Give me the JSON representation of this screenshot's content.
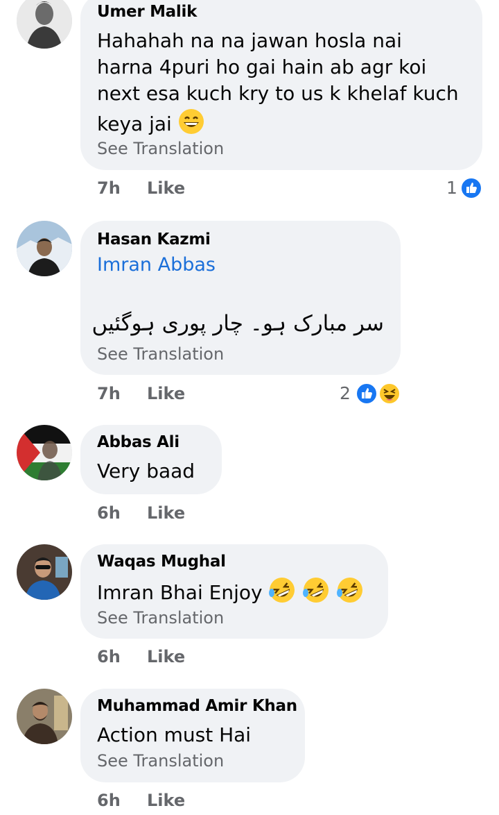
{
  "comments": [
    {
      "name": "Umer Malik",
      "lines": [
        "Hahahah na na  jawan hosla nai",
        "harna 4puri ho gai hain ab agr koi",
        "next esa kuch kry to us k khelaf kuch",
        "keya jai"
      ],
      "see_translation": "See Translation",
      "time": "7h",
      "like": "Like",
      "reaction_count": "1",
      "reaction_icons": [
        "like-reaction-icon"
      ]
    },
    {
      "name": "Hasan Kazmi",
      "mention": "Imran Abbas",
      "urdu": "سر مبارک ہو۔ چار پوری ہوگئیں",
      "see_translation": "See Translation",
      "time": "7h",
      "like": "Like",
      "reaction_count": "2",
      "reaction_icons": [
        "like-reaction-icon",
        "haha-reaction-icon"
      ]
    },
    {
      "name": "Abbas Ali",
      "lines": [
        "Very baad"
      ],
      "time": "6h",
      "like": "Like"
    },
    {
      "name": "Waqas Mughal",
      "lines": [
        "Imran Bhai Enjoy"
      ],
      "emojis": [
        "rofl-emoji",
        "rofl-emoji",
        "rofl-emoji"
      ],
      "see_translation": "See Translation",
      "time": "6h",
      "like": "Like"
    },
    {
      "name": "Muhammad Amir Khan",
      "lines": [
        "Action must Hai"
      ],
      "see_translation": "See Translation",
      "time": "6h",
      "like": "Like"
    }
  ],
  "colors": {
    "bubble": "#f0f2f5",
    "meta_text": "#65676b",
    "mention": "#1b6fd9",
    "like_blue": "#1877f2"
  }
}
